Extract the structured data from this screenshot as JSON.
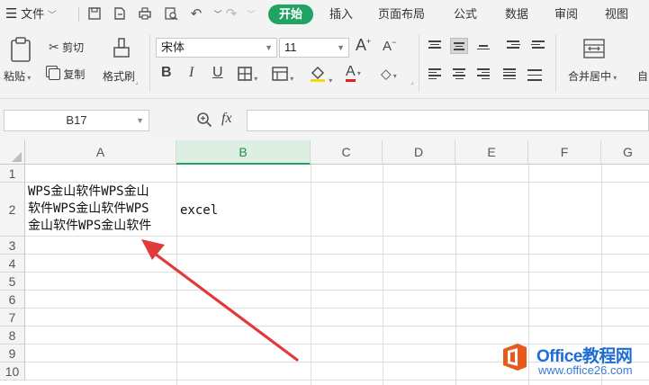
{
  "menubar": {
    "menu_icon": "hamburger-icon",
    "file_label": "文件",
    "tabs": [
      "开始",
      "插入",
      "页面布局",
      "公式",
      "数据",
      "审阅",
      "视图"
    ]
  },
  "ribbon": {
    "paste_label": "粘贴",
    "cut_label": "剪切",
    "copy_label": "复制",
    "format_painter_label": "格式刷",
    "font_name": "宋体",
    "font_size": "11",
    "bold": "B",
    "italic": "I",
    "underline": "U",
    "font_color_glyph": "A",
    "merge_center_label": "合并居中",
    "auto_label": "自"
  },
  "formula_bar": {
    "name_box": "B17",
    "fx_label": "fx",
    "formula": ""
  },
  "sheet": {
    "columns": [
      "A",
      "B",
      "C",
      "D",
      "E",
      "F",
      "G"
    ],
    "selected_column": "B",
    "rows": [
      "1",
      "2",
      "3",
      "4",
      "5",
      "6",
      "7",
      "8",
      "9",
      "10"
    ],
    "cells": {
      "A2_lines": [
        "WPS金山软件WPS金山",
        "软件WPS金山软件WPS",
        "金山软件WPS金山软件"
      ],
      "B2": "excel"
    }
  },
  "annotation": {
    "arrow_color": "#e03a3a"
  },
  "watermark": {
    "title": "Office教程网",
    "url": "www.office26.com"
  },
  "colors": {
    "accent": "#1fa463",
    "menubar_bg": "#f3f3f3",
    "header_bg": "#f4f4f4",
    "selected_header": "#dcefe2"
  }
}
